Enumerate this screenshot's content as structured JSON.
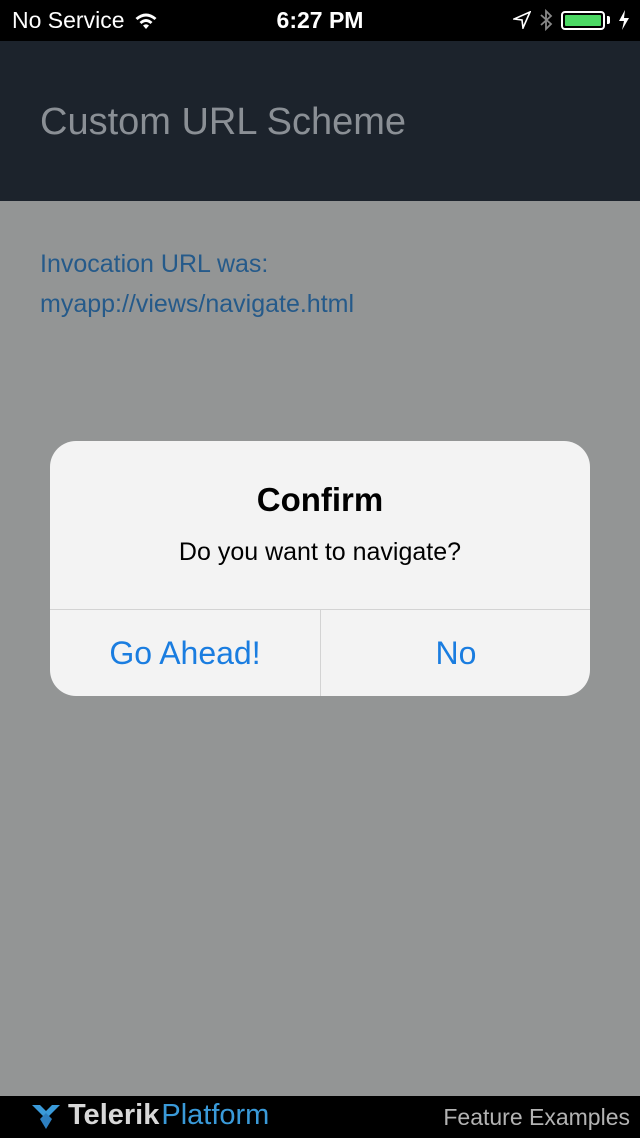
{
  "status_bar": {
    "carrier": "No Service",
    "time": "6:27 PM",
    "icons": [
      "wifi-icon",
      "location-arrow-icon",
      "bluetooth-icon",
      "battery-icon",
      "charging-bolt-icon"
    ],
    "battery_level": 1.0,
    "battery_color": "#4cd964"
  },
  "header": {
    "title": "Custom URL Scheme",
    "background": "#1c232c"
  },
  "content": {
    "line1": "Invocation URL was:",
    "line2": "myapp://views/navigate.html",
    "text_color": "#255a8a"
  },
  "dialog": {
    "title": "Confirm",
    "message": "Do you want to navigate?",
    "buttons": {
      "confirm": "Go Ahead!",
      "cancel": "No"
    },
    "button_color": "#1a7de0"
  },
  "footer": {
    "logo_bold": "Telerik",
    "logo_light": "Platform",
    "right_label": "Feature Examples",
    "logo_icon": "telerik-logo-icon"
  }
}
